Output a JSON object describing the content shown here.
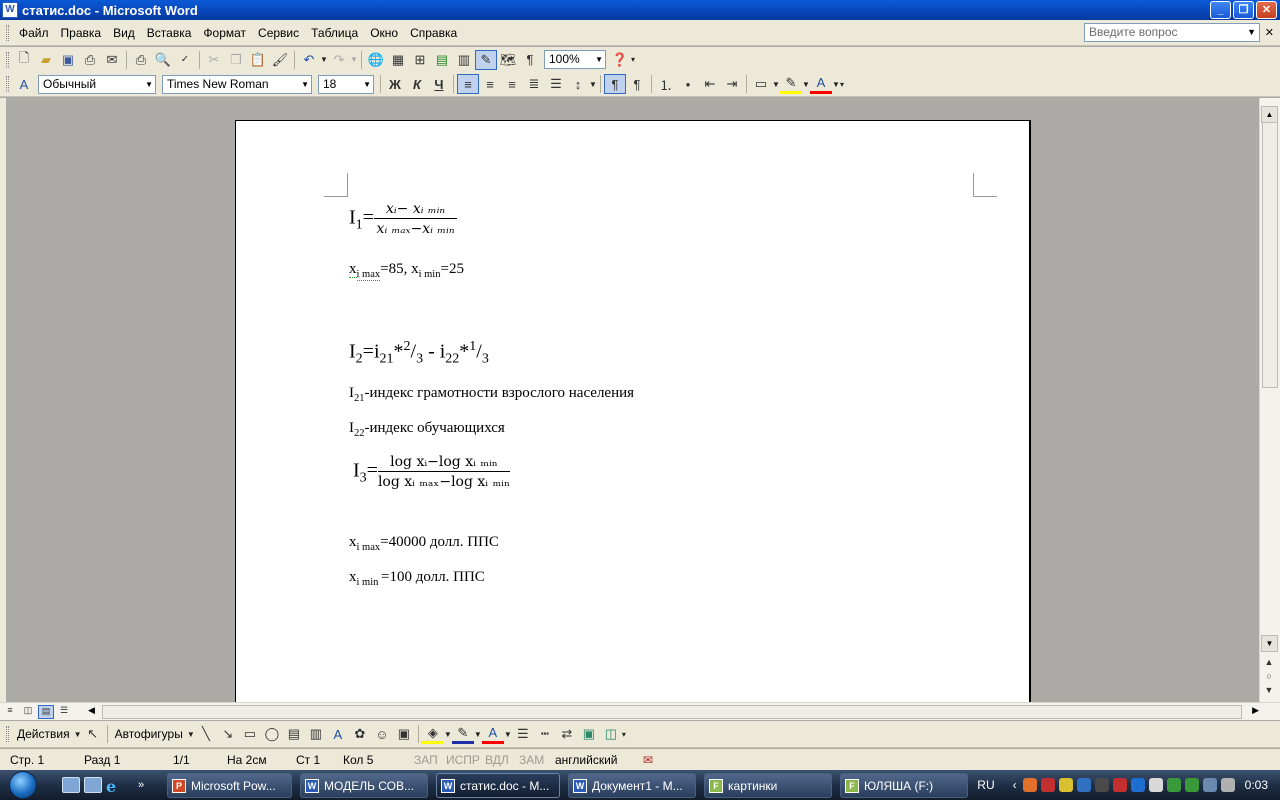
{
  "window": {
    "title": "статис.doc - Microsoft Word",
    "app_icon": "W"
  },
  "menu": {
    "items": [
      "Файл",
      "Правка",
      "Вид",
      "Вставка",
      "Формат",
      "Сервис",
      "Таблица",
      "Окно",
      "Справка"
    ],
    "help_placeholder": "Введите вопрос"
  },
  "toolbar": {
    "zoom": "100%"
  },
  "format_bar": {
    "style": "Обычный",
    "font": "Times New Roman",
    "size": "18",
    "bold_label": "Ж",
    "italic_label": "К",
    "underline_label": "Ч",
    "font_color_label": "A"
  },
  "document": {
    "eq1": {
      "lhs": "I",
      "lhs_sub": "1",
      "eq": "=",
      "num": "xᵢ− xᵢ ₘᵢₙ",
      "den": "xᵢ ₘₐₓ−xᵢ ₘᵢₙ"
    },
    "line2": {
      "a": "x",
      "a_sub": "i max",
      "b": "=85, x",
      "b_sub": "i min",
      "c": "=25"
    },
    "eq2": {
      "a": "I",
      "a_sub": "2",
      "b": "=i",
      "b_sub": "21",
      "c": "*",
      "c_sup": "2",
      "d": "/",
      "d_sub": "3",
      "e": " - i",
      "e_sub": "22",
      "f": "*",
      "f_sup": "1",
      "g": "/",
      "g_sub": "3"
    },
    "line4": {
      "a": "I",
      "a_sub": "21",
      "b": "-индекс грамотности взрослого населения"
    },
    "line5": {
      "a": "I",
      "a_sub": "22",
      "b": "-индекс обучающихся"
    },
    "eq3": {
      "lhs": "I",
      "lhs_sub": "3",
      "eq": "=",
      "num": "log xᵢ−log xᵢ ₘᵢₙ",
      "den": "log xᵢ ₘₐₓ−log xᵢ ₘᵢₙ"
    },
    "line7": {
      "a": "x",
      "a_sub": "i max",
      "b": "=40000 долл. ППС"
    },
    "line8": {
      "a": "x",
      "a_sub": "i min ",
      "b": "=100 долл. ППС"
    }
  },
  "drawing_bar": {
    "actions": "Действия",
    "autoshapes": "Автофигуры"
  },
  "status": {
    "page": "Стр. 1",
    "section": "Разд 1",
    "pages": "1/1",
    "at": "На 2см",
    "line": "Ст 1",
    "col": "Кол 5",
    "rec": "ЗАП",
    "trk": "ИСПР",
    "ext": "ВДЛ",
    "ovr": "ЗАМ",
    "lang": "английский"
  },
  "taskbar": {
    "tasks": [
      {
        "label": "Microsoft Pow...",
        "icon": "P",
        "color": "#d24726"
      },
      {
        "label": "МОДЕЛЬ СОВ...",
        "icon": "W",
        "color": "#2a5cb8"
      },
      {
        "label": "статис.doc - M...",
        "icon": "W",
        "color": "#2a5cb8"
      },
      {
        "label": "Документ1 - М...",
        "icon": "W",
        "color": "#2a5cb8"
      },
      {
        "label": "картинки",
        "icon": "F",
        "color": "#8ab84a"
      },
      {
        "label": "ЮЛЯША (F:)",
        "icon": "F",
        "color": "#8ab84a"
      }
    ],
    "lang": "RU",
    "clock": "0:03"
  },
  "colors": {
    "titlebar": "#0845b8",
    "chrome": "#ece9d8",
    "workspace": "#abaaa6",
    "taskbar": "#1f2f46"
  }
}
